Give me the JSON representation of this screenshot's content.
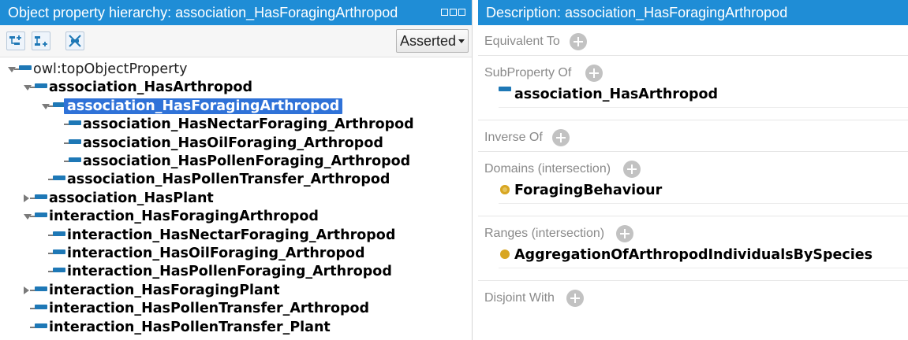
{
  "hierarchy_panel": {
    "title": "Object property hierarchy: association_HasForagingArthropod",
    "view_mode": "Asserted",
    "toolbar_icons": [
      "add-sub-property-icon",
      "add-sibling-property-icon",
      "delete-property-icon"
    ],
    "tree": [
      {
        "label": "owl:topObjectProperty",
        "depth": 0,
        "expander": "open",
        "root": true
      },
      {
        "label": "association_HasArthropod",
        "depth": 1,
        "expander": "open"
      },
      {
        "label": "association_HasForagingArthropod",
        "depth": 2,
        "expander": "open",
        "selected": true
      },
      {
        "label": "association_HasNectarForaging_Arthropod",
        "depth": 3,
        "expander": "none"
      },
      {
        "label": "association_HasOilForaging_Arthropod",
        "depth": 3,
        "expander": "none"
      },
      {
        "label": "association_HasPollenForaging_Arthropod",
        "depth": 3,
        "expander": "none"
      },
      {
        "label": "association_HasPollenTransfer_Arthropod",
        "depth": 2,
        "expander": "none"
      },
      {
        "label": "association_HasPlant",
        "depth": 1,
        "expander": "closed"
      },
      {
        "label": "interaction_HasForagingArthropod",
        "depth": 1,
        "expander": "open"
      },
      {
        "label": "interaction_HasNectarForaging_Arthropod",
        "depth": 2,
        "expander": "none"
      },
      {
        "label": "interaction_HasOilForaging_Arthropod",
        "depth": 2,
        "expander": "none"
      },
      {
        "label": "interaction_HasPollenForaging_Arthropod",
        "depth": 2,
        "expander": "none"
      },
      {
        "label": "interaction_HasForagingPlant",
        "depth": 1,
        "expander": "closed"
      },
      {
        "label": "interaction_HasPollenTransfer_Arthropod",
        "depth": 1,
        "expander": "none"
      },
      {
        "label": "interaction_HasPollenTransfer_Plant",
        "depth": 1,
        "expander": "none"
      }
    ]
  },
  "description_panel": {
    "title": "Description: association_HasForagingArthropod",
    "sections": [
      {
        "key": "equivalent_to",
        "label": "Equivalent To",
        "entries": []
      },
      {
        "key": "subproperty_of",
        "label": "SubProperty Of",
        "entries": [
          {
            "label": "association_HasArthropod",
            "icon": "object-property-icon"
          }
        ]
      },
      {
        "key": "inverse_of",
        "label": "Inverse Of",
        "entries": []
      },
      {
        "key": "domains",
        "label": "Domains (intersection)",
        "entries": [
          {
            "label": "ForagingBehaviour",
            "icon": "class-icon"
          }
        ]
      },
      {
        "key": "ranges",
        "label": "Ranges (intersection)",
        "entries": [
          {
            "label": "AggregationOfArthropodIndividualsBySpecies",
            "icon": "class-icon"
          }
        ]
      },
      {
        "key": "disjoint_with",
        "label": "Disjoint With",
        "entries": []
      }
    ]
  },
  "colors": {
    "header_bg": "#1f8dd6",
    "selection_bg": "#2f72d8",
    "property_icon": "#1e78b6",
    "class_icon": "#d8a623",
    "section_label": "#8a8a8a",
    "add_button": "#c2c2c2"
  }
}
